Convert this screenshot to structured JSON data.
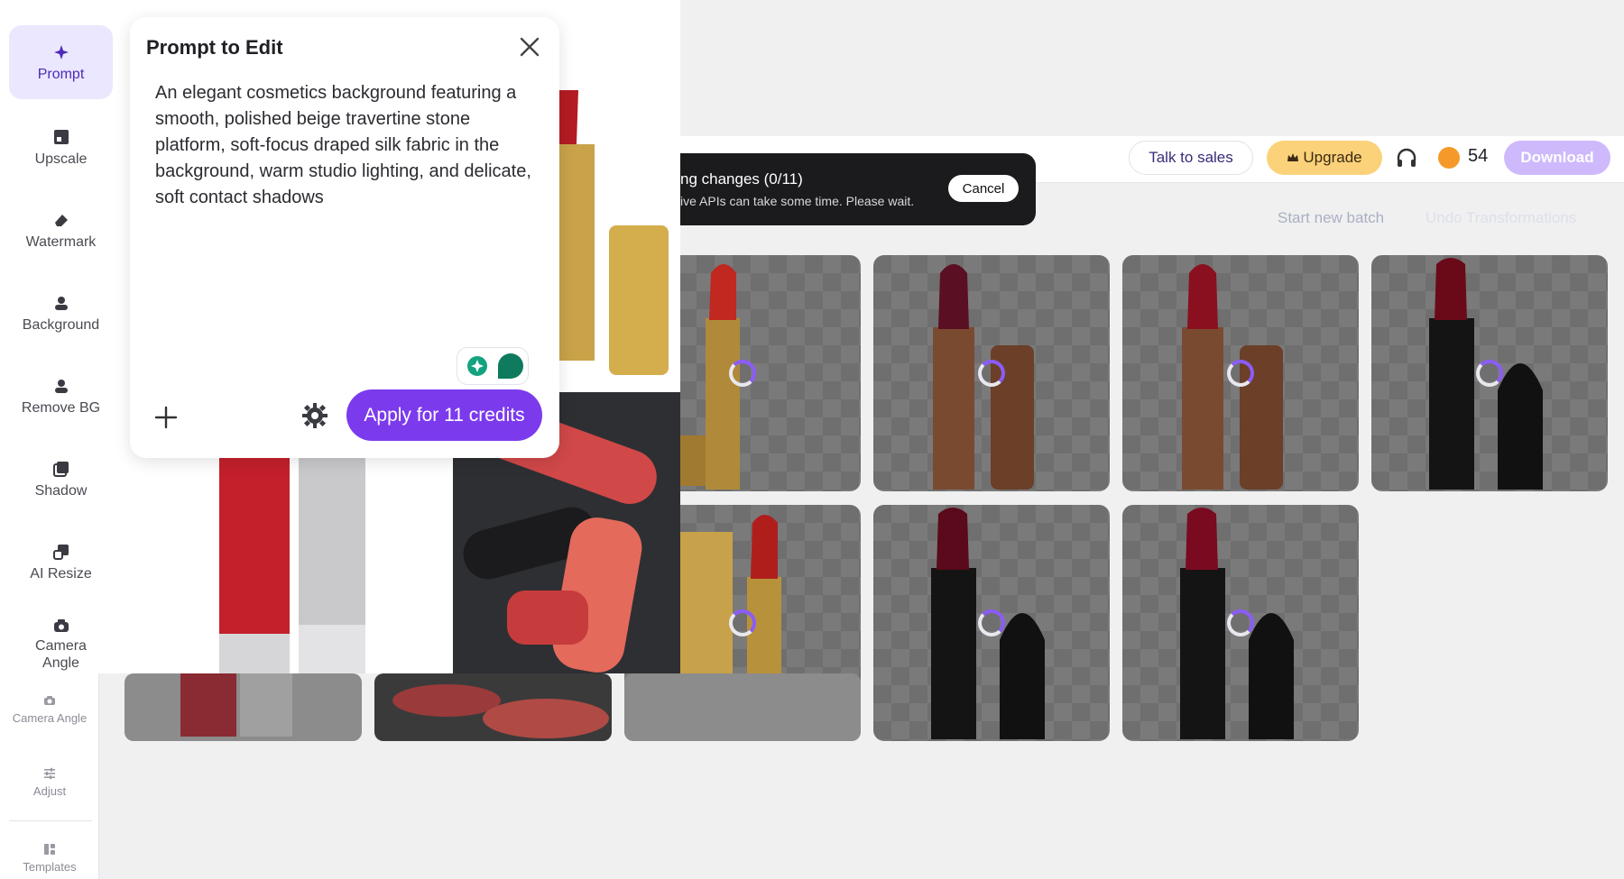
{
  "prompt_panel": {
    "title": "Prompt to Edit",
    "text": "An elegant cosmetics background featuring a smooth, polished beige travertine stone platform, soft-focus draped silk fabric in the background, warm studio lighting, and delicate, soft contact shadows",
    "apply_label": "Apply for 11 credits"
  },
  "tools_rail": [
    {
      "label": "Prompt",
      "icon": "sparkle-icon",
      "active": true
    },
    {
      "label": "Upscale",
      "icon": "upscale-icon"
    },
    {
      "label": "Watermark",
      "icon": "eraser-icon"
    },
    {
      "label": "Background",
      "icon": "background-icon"
    },
    {
      "label": "Remove BG",
      "icon": "remove-bg-icon"
    },
    {
      "label": "Shadow",
      "icon": "shadow-icon"
    },
    {
      "label": "AI Resize",
      "icon": "resize-icon"
    },
    {
      "label": "Camera Angle",
      "icon": "camera-icon"
    }
  ],
  "app_sidebar": [
    {
      "label": "Camera Angle",
      "icon": "camera-icon"
    },
    {
      "label": "Adjust",
      "icon": "sliders-icon"
    },
    {
      "label": "Templates",
      "icon": "templates-icon"
    }
  ],
  "topbar": {
    "talk_label": "Talk to sales",
    "upgrade_label": "Upgrade",
    "credits": "54",
    "download_label": "Download"
  },
  "actions": {
    "start_new_batch": "Start new batch",
    "undo": "Undo Transformations"
  },
  "toast": {
    "title": "ng changes (0/11)",
    "subtitle": "ive APIs can take some time. Please wait.",
    "cancel_label": "Cancel"
  },
  "colors": {
    "accent": "#7c3aed",
    "active_bg": "#ebe7ff",
    "upgrade": "#fbd27a",
    "download": "#cdb9fb"
  }
}
